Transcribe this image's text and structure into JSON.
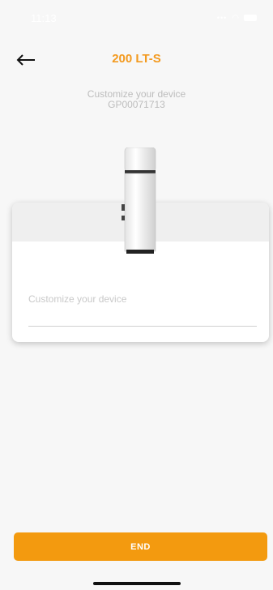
{
  "status_bar": {
    "time": "11:13"
  },
  "header": {
    "back_icon": "arrow-left-icon",
    "title": "200 LT-S",
    "subtitle_line1": "Customize your device",
    "subtitle_line2": "GP00071713"
  },
  "form": {
    "field_label": "Customize your device",
    "field_value": ""
  },
  "footer": {
    "end_label": "END"
  },
  "colors": {
    "accent": "#f39a1f",
    "button": "#f39a0f"
  }
}
